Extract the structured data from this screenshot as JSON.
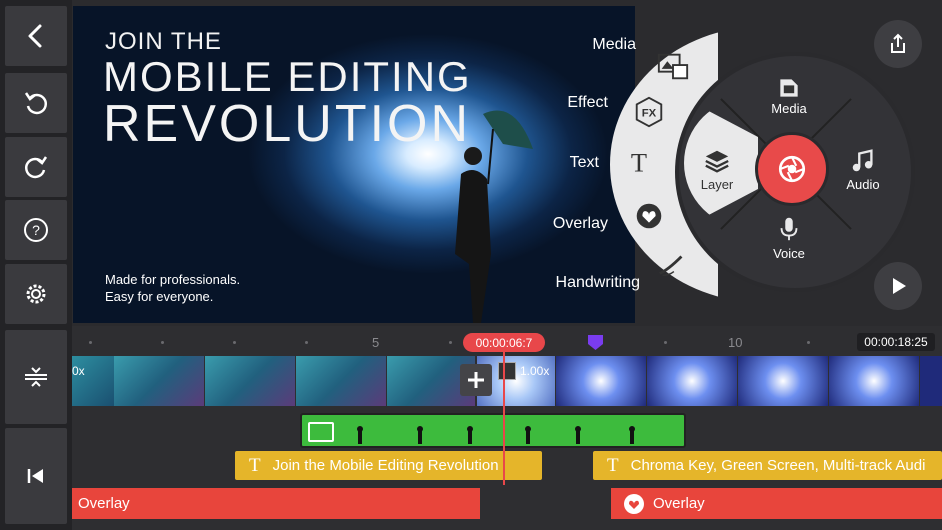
{
  "preview": {
    "headline_1": "JOIN THE",
    "headline_2": "MOBILE EDITING",
    "headline_3": "REVOLUTION",
    "sub_1": "Made for professionals.",
    "sub_2": "Easy for everyone."
  },
  "radial_menu": {
    "outer_items": [
      "Media",
      "Effect",
      "Text",
      "Overlay",
      "Handwriting"
    ],
    "inner_items": {
      "media": "Media",
      "layer": "Layer",
      "audio": "Audio",
      "voice": "Voice"
    }
  },
  "timeline": {
    "current_time": "00:00:06:7",
    "end_time": "00:00:18:25",
    "ruler_marks": [
      "5",
      "10"
    ],
    "speed_left": "0x",
    "speed_right": "1.00x",
    "text_clip_1": "Join the Mobile Editing Revolution",
    "text_clip_2": "Chroma Key, Green Screen, Multi-track Audi",
    "overlay_clip_1": "Overlay",
    "overlay_clip_2": "Overlay"
  },
  "colors": {
    "accent_red": "#e8474a",
    "text_clip": "#e5b52a",
    "overlay_clip": "#e8453c",
    "green_clip": "#3dbb3d",
    "marker": "#7a3cf0"
  }
}
